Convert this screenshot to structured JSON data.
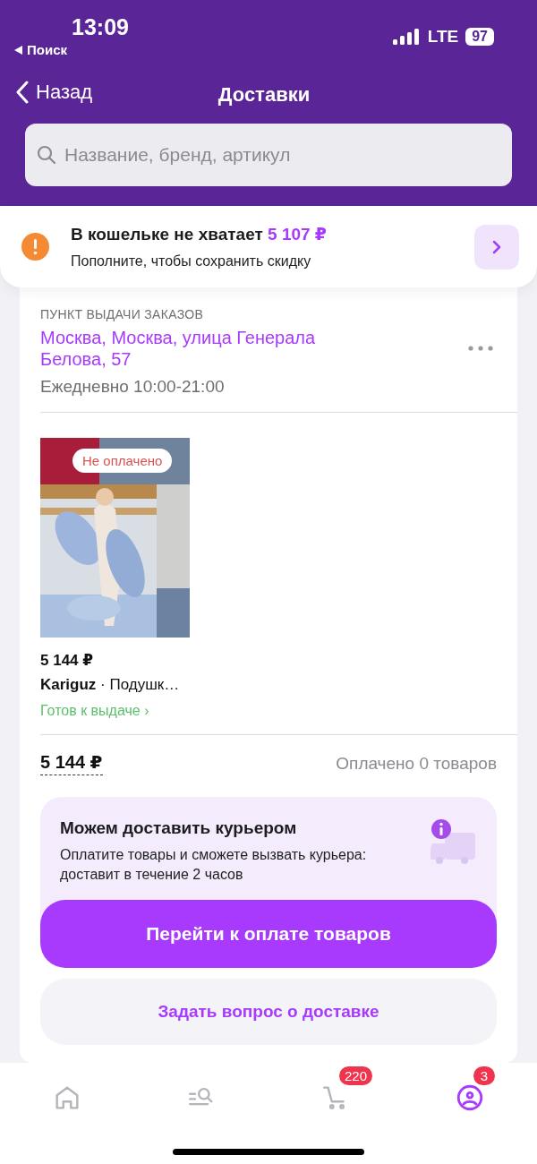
{
  "status_bar": {
    "time": "13:09",
    "back_app": "Поиск",
    "network": "LTE",
    "battery": "97"
  },
  "nav": {
    "back": "Назад",
    "title": "Доставки"
  },
  "search": {
    "placeholder": "Название, бренд, артикул"
  },
  "wallet_alert": {
    "title": "В кошельке не хватает",
    "amount": "5 107 ₽",
    "subtitle": "Пополните, чтобы сохранить скидку"
  },
  "pickup": {
    "label": "ПУНКТ ВЫДАЧИ ЗАКАЗОВ",
    "address": "Москва, Москва, улица Генерала Белова, 57",
    "hours": "Ежедневно 10:00-21:00"
  },
  "items": [
    {
      "kind": "picture",
      "badge": "Не оплачено",
      "price": "5 144 ₽",
      "brand": "Kariguz",
      "name": "· Подушк…",
      "status": "Готов к выдаче ›"
    }
  ],
  "summary": {
    "total": "5 144 ₽",
    "paid": "Оплачено 0 товаров"
  },
  "courier": {
    "title": "Можем доставить курьером",
    "text": "Оплатите товары и сможете вызвать курьера: доставит в течение 2 часов"
  },
  "buttons": {
    "pay": "Перейти к оплате товаров",
    "ask": "Задать вопрос о доставке"
  },
  "tab_bar": [
    {
      "kind": "home",
      "selected": false
    },
    {
      "kind": "catalog",
      "selected": false
    },
    {
      "kind": "cart",
      "selected": false,
      "badge": "220"
    },
    {
      "kind": "profile",
      "selected": true,
      "badge": "3"
    }
  ]
}
